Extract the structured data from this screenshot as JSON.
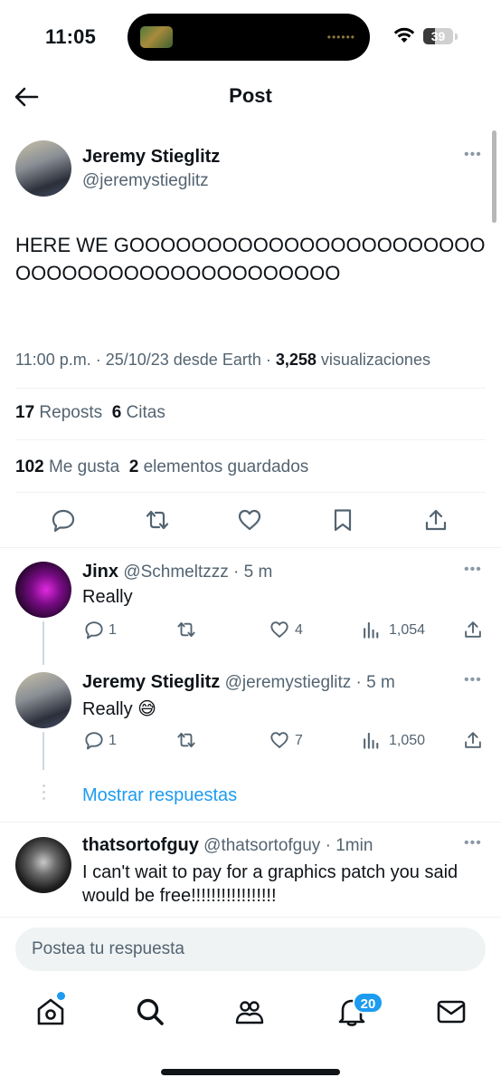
{
  "status_bar": {
    "time": "11:05",
    "battery": "39"
  },
  "header": {
    "title": "Post"
  },
  "post": {
    "author_name": "Jeremy Stieglitz",
    "author_handle": "@jeremystieglitz",
    "text": "HERE WE GOOOOOOOOOOOOOOOOOOOOOOOOOOOOOOOOOOOOOOOOOOOO",
    "meta_prefix": "11:00 p.m. · 25/10/23 desde Earth · ",
    "views_count": "3,258",
    "views_label": " visualizaciones",
    "reposts_count": "17",
    "reposts_label": "Reposts",
    "quotes_count": "6",
    "quotes_label": "Citas",
    "likes_count": "102",
    "likes_label": "Me gusta",
    "bookmarks_count": "2",
    "bookmarks_label": "elementos guardados"
  },
  "replies": [
    {
      "name": "Jinx",
      "handle": "@Schmeltzzz",
      "time": "· 5 m",
      "text": "Really",
      "replies": "1",
      "likes": "4",
      "views": "1,054"
    },
    {
      "name": "Jeremy Stieglitz",
      "handle": "@jeremystieglitz",
      "time": "· 5 m",
      "text": "Really 😅",
      "replies": "1",
      "likes": "7",
      "views": "1,050"
    },
    {
      "name": "thatsortofguy",
      "handle": "@thatsortofguy",
      "time": "· 1min",
      "text": "I can't wait to pay for a graphics patch you said would be free!!!!!!!!!!!!!!!!!"
    }
  ],
  "show_replies": "Mostrar respuestas",
  "composer": {
    "placeholder": "Postea tu respuesta"
  },
  "bottom_nav": {
    "notifications_badge": "20"
  },
  "colors": {
    "accent": "#1d9bf0",
    "text": "#0f1419",
    "muted": "#536471",
    "divider": "#eff3f4"
  },
  "icons": [
    "back-arrow-icon",
    "more-icon",
    "reply-icon",
    "repost-icon",
    "like-icon",
    "bookmark-icon",
    "share-icon",
    "views-icon",
    "home-icon",
    "search-icon",
    "communities-icon",
    "notifications-icon",
    "messages-icon"
  ]
}
